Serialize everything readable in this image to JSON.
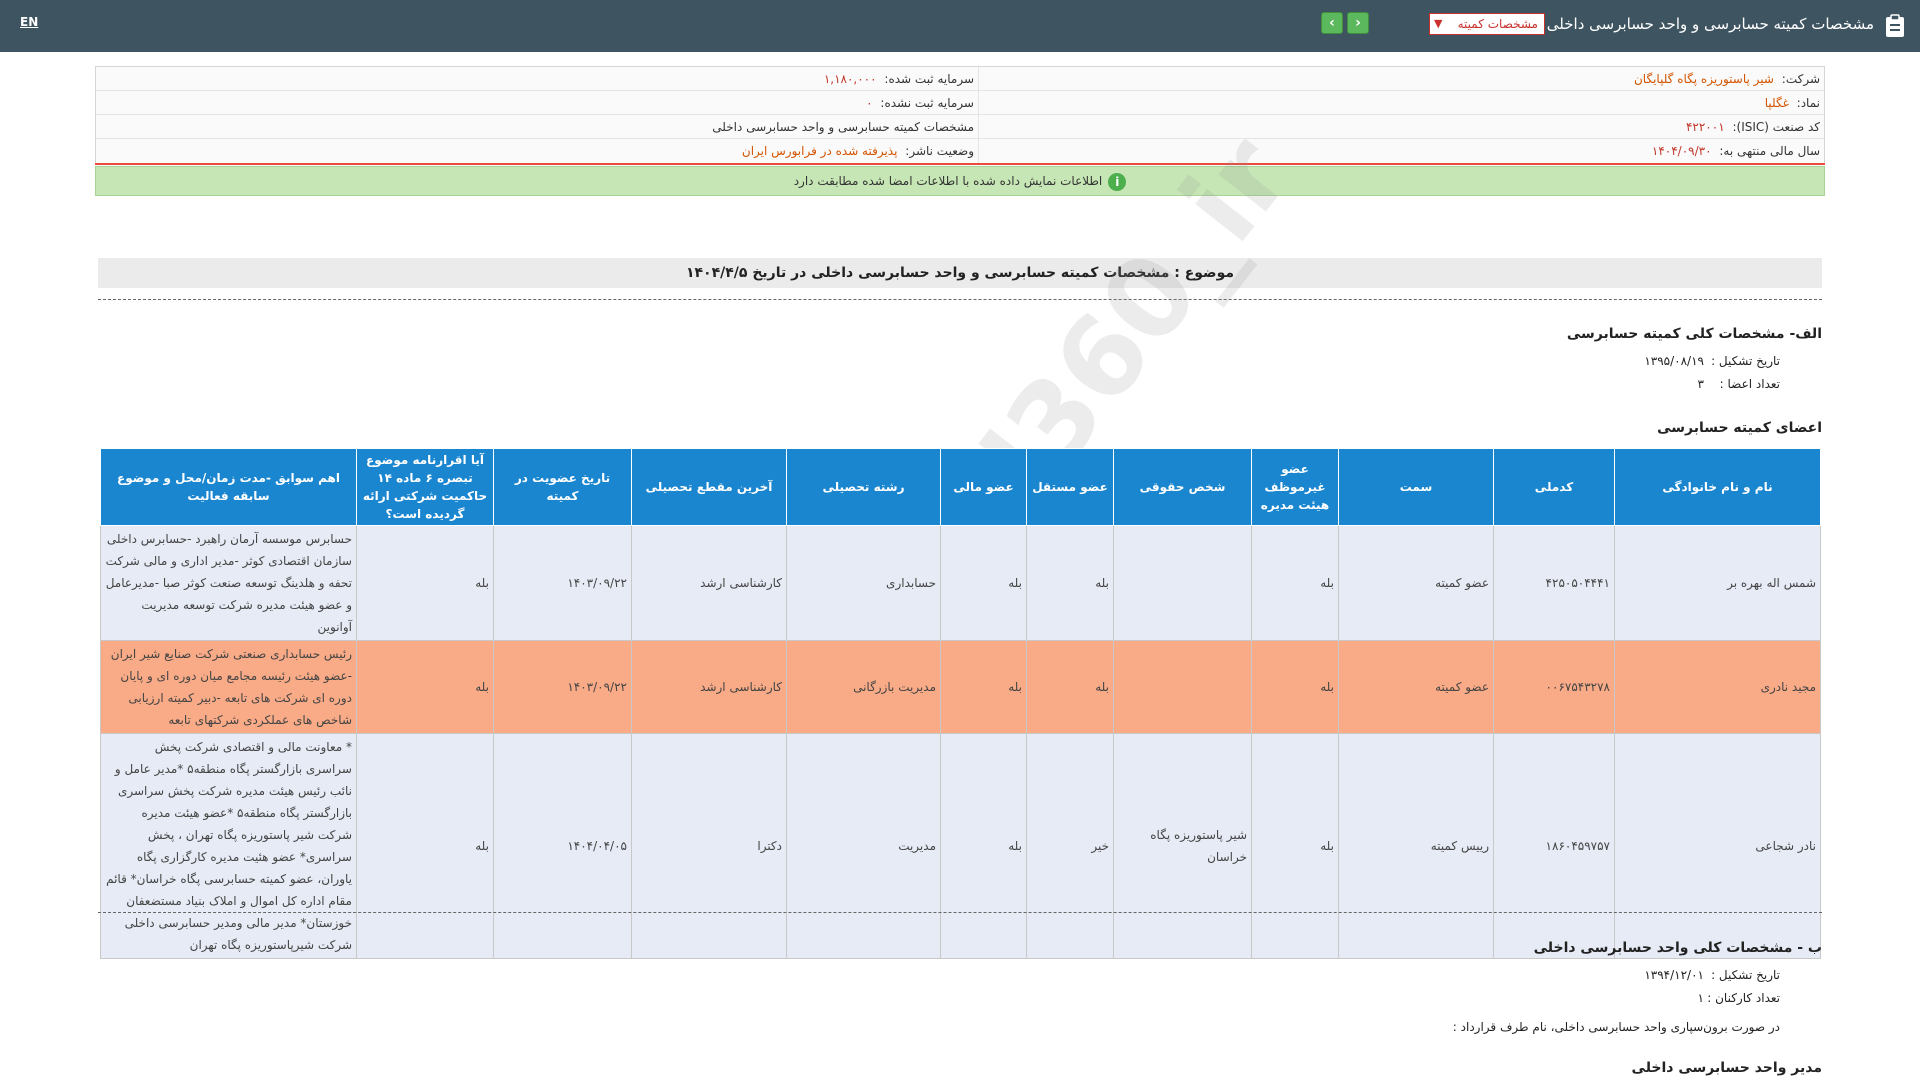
{
  "topbar": {
    "title": "مشخصات کمیته حسابرسی و واحد حسابرسی داخلی",
    "selected_report": "مشخصات کمیته",
    "lang": "EN"
  },
  "info": {
    "company_label": "شرکت:",
    "company_value": "شیر پاستوریزه پگاه گلپایگان",
    "symbol_label": "نماد:",
    "symbol_value": "غگلپا",
    "isic_label": "کد صنعت (ISIC):",
    "isic_value": "۴۲۲۰۰۱",
    "fiscal_label": "سال مالی منتهی به:",
    "fiscal_value": "۱۴۰۴/۰۹/۳۰",
    "reg_capital_label": "سرمایه ثبت شده:",
    "reg_capital_value": "۱,۱۸۰,۰۰۰",
    "unreg_capital_label": "سرمایه ثبت نشده:",
    "unreg_capital_value": "۰",
    "report_name": "مشخصات کمیته حسابرسی و واحد حسابرسی داخلی",
    "publisher_status_label": "وضعیت ناشر:",
    "publisher_status_value": "پذیرفته شده در فرابورس ایران"
  },
  "notice": "اطلاعات نمایش داده شده با اطلاعات امضا شده مطابقت دارد",
  "subject": "موضوع : مشخصات کمیته حسابرسی و واحد حسابرسی داخلی در تاریخ ۱۴۰۴/۴/۵",
  "section_a": {
    "title": "الف- مشخصات کلی کمیته حسابرسی",
    "formation_label": "تاریخ تشکیل :",
    "formation_value": "۱۳۹۵/۰۸/۱۹",
    "members_count_label": "تعداد اعضا :",
    "members_count_value": "۳"
  },
  "members_title": "اعضای کمیته حسابرسی",
  "table": {
    "headers": [
      "نام و نام خانوادگی",
      "کدملی",
      "سمت",
      "عضو غیرموظف هیئت مدیره",
      "شخص حقوقی",
      "عضو مستقل",
      "عضو مالی",
      "رشته تحصیلی",
      "آخرین مقطع تحصیلی",
      "تاریخ عضویت در کمیته",
      "آیا اقرارنامه موضوع تبصره ۶ ماده ۱۴ حاکمیت شرکتی ارائه گردیده است؟",
      "اهم سوابق -مدت زمان/محل و موضوع سابقه فعالیت"
    ],
    "rows": [
      {
        "name": "شمس اله بهره بر",
        "national_id": "۴۲۵۰۵۰۴۴۴۱",
        "position": "عضو کمیته",
        "non_exec": "بله",
        "legal_entity": "",
        "independent": "بله",
        "financial": "بله",
        "field": "حسابداری",
        "degree": "کارشناسی ارشد",
        "membership_date": "۱۴۰۳/۰۹/۲۲",
        "declaration": "بله",
        "history": "حسابرس موسسه آرمان راهبرد -حسابرس داخلی سازمان اقتصادی کوثر -مدیر اداری و مالی شرکت تحفه و هلدینگ توسعه صنعت کوثر صبا -مدیرعامل و عضو هیئت مدیره شرکت توسعه مدیریت آوانوین"
      },
      {
        "name": "مجید نادری",
        "national_id": "۰۰۶۷۵۴۳۲۷۸",
        "position": "عضو کمیته",
        "non_exec": "بله",
        "legal_entity": "",
        "independent": "بله",
        "financial": "بله",
        "field": "مدیریت بازرگانی",
        "degree": "کارشناسی ارشد",
        "membership_date": "۱۴۰۳/۰۹/۲۲",
        "declaration": "بله",
        "history": "رئیس حسابداری صنعتی شرکت صنایع شیر ایران -عضو هیئت رئیسه مجامع میان دوره ای و پایان دوره ای شرکت های تابعه -دبیر کمیته ارزیابی شاخص های عملکردی شرکتهای تابعه"
      },
      {
        "name": "نادر شجاعی",
        "national_id": "۱۸۶۰۴۵۹۷۵۷",
        "position": "رییس کمیته",
        "non_exec": "بله",
        "legal_entity": "شیر پاستوریزه پگاه خراسان",
        "independent": "خیر",
        "financial": "بله",
        "field": "مدیریت",
        "degree": "دکترا",
        "membership_date": "۱۴۰۴/۰۴/۰۵",
        "declaration": "بله",
        "history": "* معاونت مالی و اقتصادی شرکت پخش سراسری بازارگستر پگاه منطقه۵ *مدیر عامل و نائب رئیس هیئت مدیره شرکت پخش سراسری بازارگستر پگاه منطقه۵ *عضو هیئت مدیره شرکت شیر پاستوریزه پگاه تهران ، پخش سراسری* عضو هئیت مدیره کارگزاری پگاه یاوران، عضو کمیته حسابرسی پگاه خراسان* قائم مقام اداره کل اموال و املاک بنیاد مستضعفان خوزستان* مدیر مالی ومدیر حسابرسی داخلی شرکت شیرپاستوریزه پگاه تهران"
      }
    ]
  },
  "section_b": {
    "title": "ب - مشخصات کلی واحد حسابرسی داخلی",
    "formation_label": "تاریخ تشکیل :",
    "formation_value": "۱۳۹۴/۱۲/۰۱",
    "staff_label": "تعداد کارکنان :",
    "staff_value": "۱",
    "outsourcing_text": "در صورت برون‌سپاری واحد حسابرسی داخلی، نام طرف قرارداد :"
  },
  "internal_audit_manager_title": "مدیر واحد حسابرسی داخلی",
  "watermark": "@Codal360_ir"
}
